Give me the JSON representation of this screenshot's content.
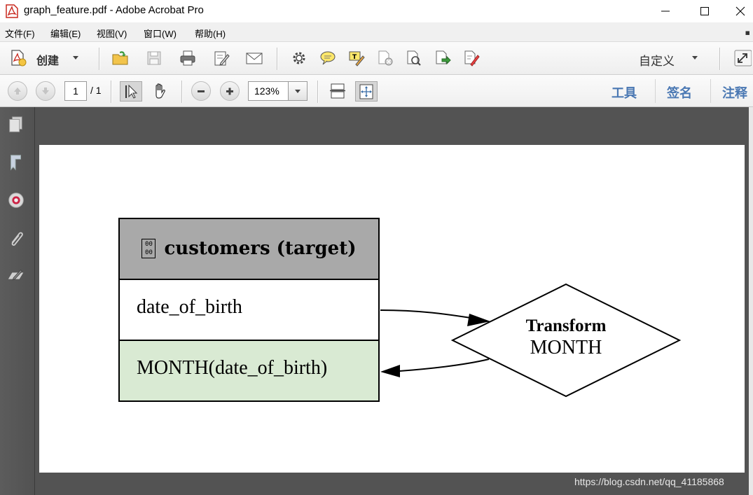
{
  "window": {
    "title": "graph_feature.pdf - Adobe Acrobat Pro"
  },
  "menu": {
    "items": [
      "文件(F)",
      "编辑(E)",
      "视图(V)",
      "窗口(W)",
      "帮助(H)"
    ]
  },
  "toolbar": {
    "create_label": "创建",
    "custom_label": "自定义"
  },
  "navbar": {
    "page_current": "1",
    "page_total": "/ 1",
    "zoom": "123%",
    "links": [
      "工具",
      "签名",
      "注释"
    ]
  },
  "diagram": {
    "entity": {
      "title": "customers (target)",
      "icon_glyph_top": "00",
      "icon_glyph_bottom": "00",
      "fields": [
        "date_of_birth",
        "MONTH(date_of_birth)"
      ],
      "header_fill": "#a9a9a9",
      "derived_fill": "#d9ead3"
    },
    "transform": {
      "title": "Transform",
      "subtitle": "MONTH"
    }
  },
  "watermark": "https://blog.csdn.net/qq_41185868",
  "colors": {
    "link_blue": "#4a78b3",
    "doc_background": "#535353",
    "nav_panel": "#585858"
  }
}
